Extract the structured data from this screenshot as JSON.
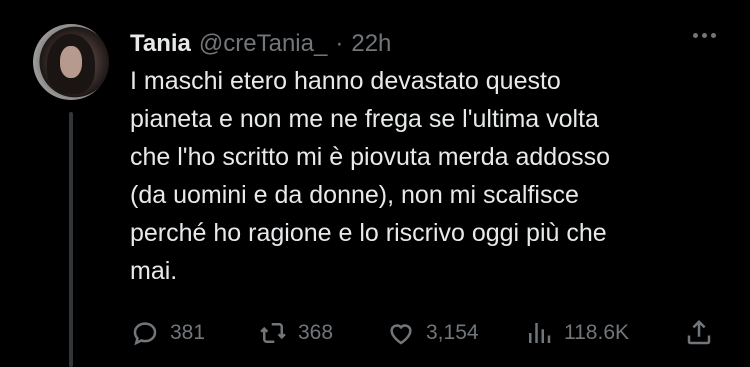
{
  "tweet": {
    "author_name": "Tania",
    "author_handle": "@creTania_",
    "separator": "·",
    "time": "22h",
    "text": "I maschi etero hanno devastato questo\npianeta e non me ne frega se l'ultima volta\nche l'ho scritto mi è piovuta merda addosso\n(da uomini e da donne), non mi scalfisce\nperché ho ragione e lo riscrivo oggi più che\nmai.",
    "stats": {
      "replies": "381",
      "retweets": "368",
      "likes": "3,154",
      "views": "118.6K"
    }
  },
  "icons": {
    "reply": "reply-icon",
    "retweet": "retweet-icon",
    "like": "heart-icon",
    "views": "views-icon",
    "share": "share-icon",
    "more": "more-icon"
  },
  "colors": {
    "background": "#000000",
    "text": "#e7e9ea",
    "muted": "#71767b",
    "thread_line": "#333639"
  }
}
